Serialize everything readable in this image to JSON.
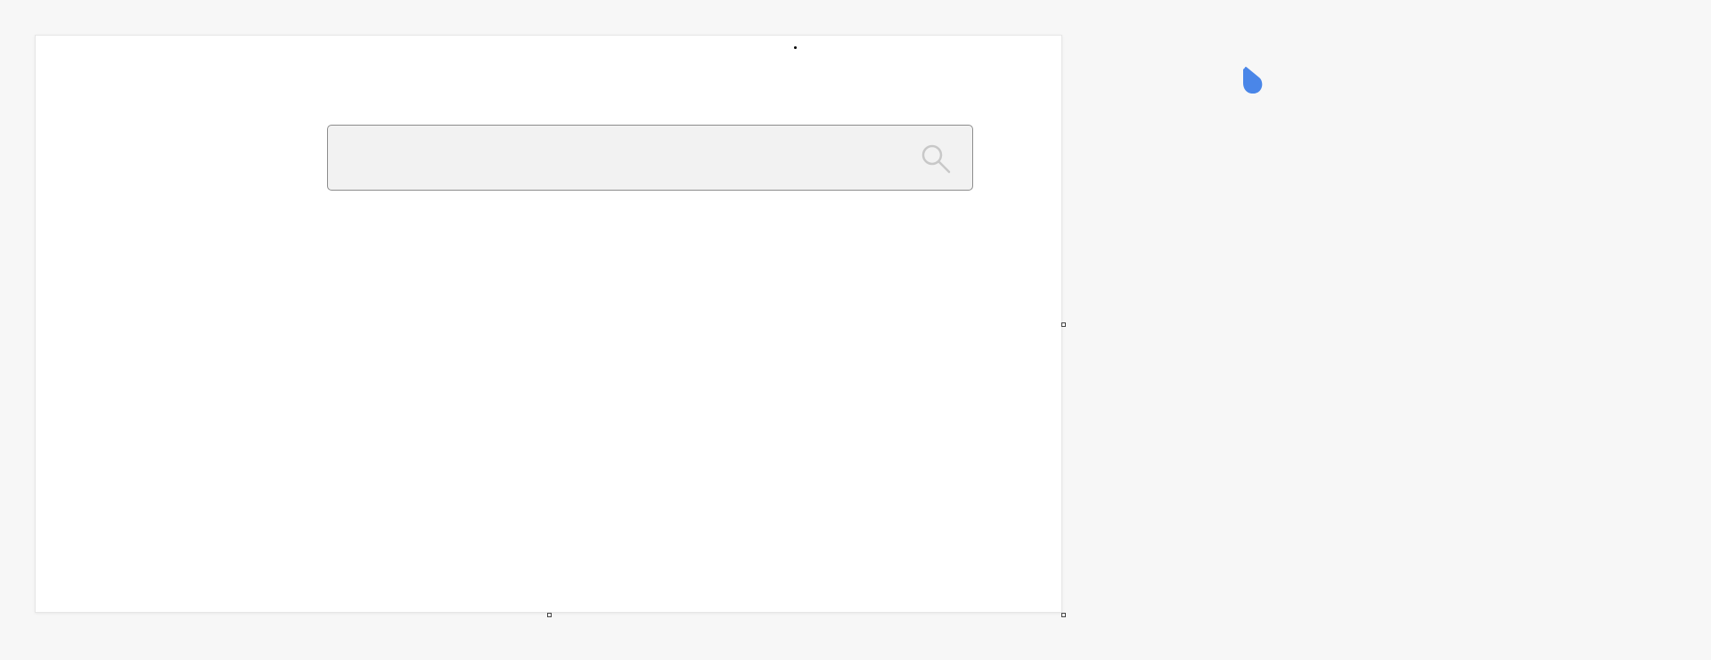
{
  "canvas": {
    "background": "#f7f7f7",
    "frame_background": "#ffffff"
  },
  "search": {
    "value": "",
    "placeholder": "",
    "icon": "search-icon",
    "box_background": "#f2f2f2",
    "border_color": "#8c8c8c",
    "icon_color": "#c8c8c8"
  },
  "cursor": {
    "icon": "droplet-cursor-icon",
    "color": "#4a86e8"
  },
  "handles": {
    "icon": "resize-handle-icon"
  }
}
